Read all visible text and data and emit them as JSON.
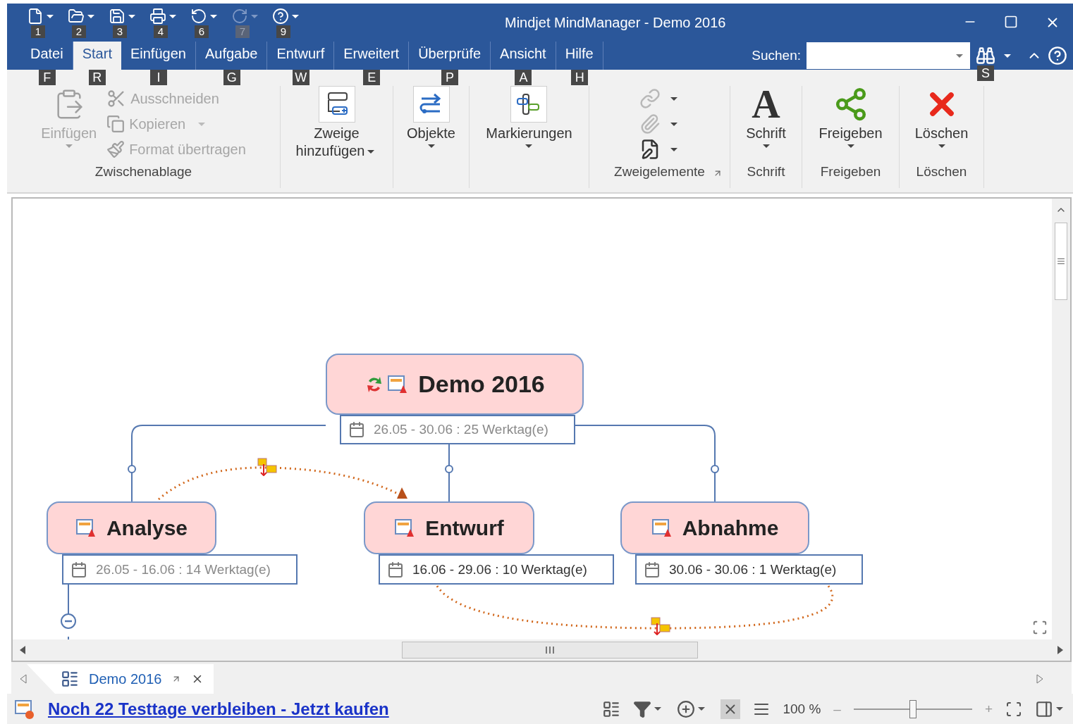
{
  "window": {
    "title": "Mindjet MindManager - Demo 2016"
  },
  "quick_access": [
    {
      "keytip": "1",
      "disabled": false
    },
    {
      "keytip": "2",
      "disabled": false
    },
    {
      "keytip": "3",
      "disabled": false
    },
    {
      "keytip": "4",
      "disabled": false
    },
    {
      "keytip": "6",
      "disabled": false
    },
    {
      "keytip": "7",
      "disabled": true
    },
    {
      "keytip": "9",
      "disabled": false
    }
  ],
  "tabs": [
    {
      "label": "Datei",
      "keytip": "F",
      "selected": false
    },
    {
      "label": "Start",
      "keytip": "R",
      "selected": true
    },
    {
      "label": "Einfügen",
      "keytip": "I",
      "selected": false
    },
    {
      "label": "Aufgabe",
      "keytip": "G",
      "selected": false
    },
    {
      "label": "Entwurf",
      "keytip": "W",
      "selected": false
    },
    {
      "label": "Erweitert",
      "keytip": "E",
      "selected": false
    },
    {
      "label": "Überprüfe",
      "keytip": "P",
      "selected": false
    },
    {
      "label": "Ansicht",
      "keytip": "A",
      "selected": false
    },
    {
      "label": "Hilfe",
      "keytip": "H",
      "selected": false
    }
  ],
  "search": {
    "label": "Suchen:",
    "keytip": "S"
  },
  "ribbon": [
    {
      "label": "Zwischenablage",
      "buttons": [
        {
          "kind": "large",
          "label": "Einfügen",
          "disabled": true,
          "dropdown": true
        },
        {
          "kind": "small",
          "label": "Ausschneiden",
          "disabled": true,
          "dropdown": false
        },
        {
          "kind": "small",
          "label": "Kopieren",
          "disabled": true,
          "dropdown": true
        },
        {
          "kind": "small",
          "label": "Format übertragen",
          "disabled": true,
          "dropdown": false
        }
      ]
    },
    {
      "buttons": [
        {
          "kind": "large",
          "label": "Zweige hinzufügen",
          "disabled": false,
          "dropdown": true
        }
      ]
    },
    {
      "buttons": [
        {
          "kind": "large",
          "label": "Objekte",
          "disabled": false,
          "dropdown": true
        }
      ]
    },
    {
      "buttons": [
        {
          "kind": "large",
          "label": "Markierungen",
          "disabled": false,
          "dropdown": true
        }
      ]
    },
    {
      "label": "Zweigelemente",
      "launcher": true,
      "buttons": [
        {
          "kind": "icon",
          "disabled": true,
          "dropdown": true
        },
        {
          "kind": "icon",
          "disabled": true,
          "dropdown": true
        },
        {
          "kind": "icon",
          "disabled": false,
          "dropdown": true
        }
      ]
    },
    {
      "label": "Schrift",
      "buttons": [
        {
          "kind": "glyph",
          "glyph": "A",
          "label": "Schrift",
          "disabled": false,
          "dropdown": true
        }
      ]
    },
    {
      "label": "Freigeben",
      "buttons": [
        {
          "kind": "large",
          "label": "Freigeben",
          "disabled": false,
          "dropdown": true
        }
      ]
    },
    {
      "label": "Löschen",
      "buttons": [
        {
          "kind": "large",
          "label": "Löschen",
          "disabled": false,
          "dropdown": true
        }
      ]
    }
  ],
  "map": {
    "central": {
      "title": "Demo 2016",
      "dates": "26.05 - 30.06 : 25 Werktag(e)",
      "muted": true
    },
    "topics": [
      {
        "title": "Analyse",
        "dates": "26.05 - 16.06 : 14 Werktag(e)",
        "muted": true,
        "expanded": true
      },
      {
        "title": "Entwurf",
        "dates": "16.06 - 29.06 : 10 Werktag(e)",
        "muted": false
      },
      {
        "title": "Abnahme",
        "dates": "30.06 - 30.06 : 1 Werktag(e)",
        "muted": false
      }
    ]
  },
  "doc_tabs": [
    {
      "label": "Demo 2016",
      "selected": true
    }
  ],
  "status_bar": {
    "trial_link": "Noch 22 Testtage verbleiben - Jetzt kaufen",
    "zoom": "100 %",
    "zoom_out": "–",
    "zoom_in": "+",
    "zoom_slider": {
      "level": 0.5
    }
  }
}
